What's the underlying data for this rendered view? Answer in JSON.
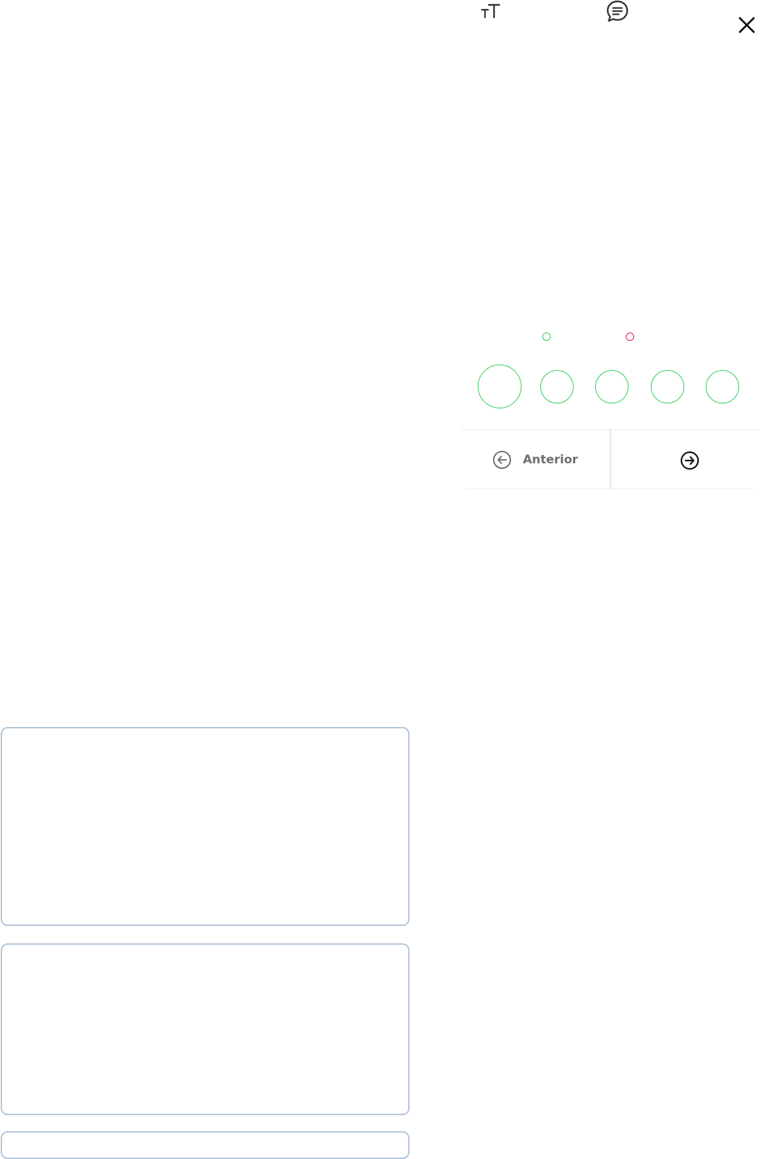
{
  "toolbar": {
    "text_size_icon": "text-size-icon",
    "comments_icon": "comments-icon",
    "close_icon": "close-icon"
  },
  "indicators": {
    "green_dot_color": "#2ecc54",
    "red_dot_color": "#e0173e"
  },
  "progress": {
    "circle_color": "#2ecc54",
    "count": 5
  },
  "navigation": {
    "prev_label": "Anterior",
    "prev_icon": "arrow-left-circle-icon",
    "next_icon": "arrow-right-circle-icon"
  },
  "colors": {
    "card_border": "#b3c5d9",
    "divider": "#dfe6ef",
    "prev_text": "#6f6f6f"
  }
}
